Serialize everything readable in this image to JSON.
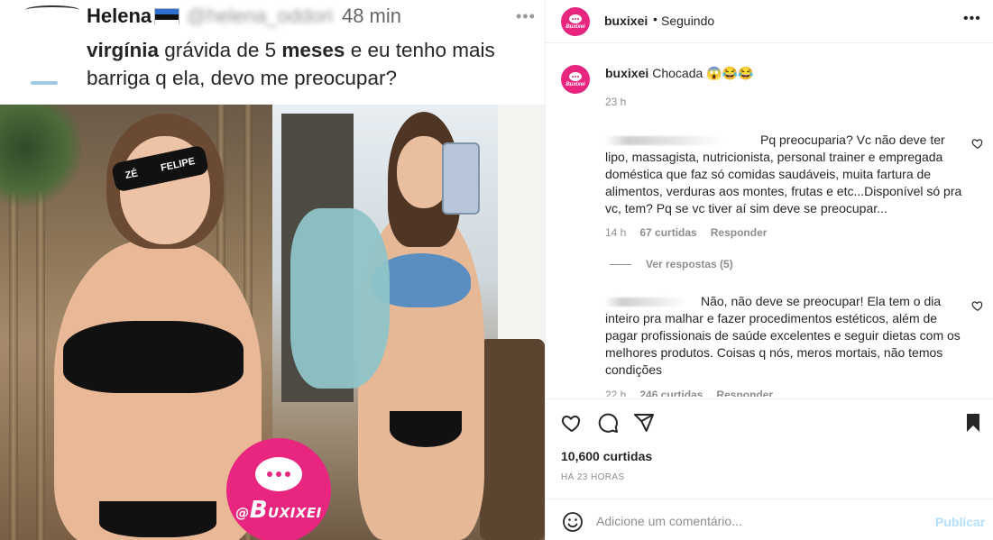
{
  "media": {
    "tweet": {
      "name": "Helena",
      "handle": "@helena_oddori",
      "time": "48 min",
      "text_bold_1": "virgínia",
      "text_mid": " grávida de 5 ",
      "text_bold_2": "meses",
      "text_end": " e eu tenho mais barriga q ela, devo me preocupar?"
    },
    "photo_left_glasses": [
      "ZÉ",
      "FELIPE"
    ],
    "brand_badge": {
      "at": "@",
      "b": "B",
      "text": "UXIXEI"
    }
  },
  "header": {
    "username": "buxixei",
    "separator": "•",
    "follow_status": "Seguindo"
  },
  "caption": {
    "username": "buxixei",
    "text": "Chocada 😱😂😂",
    "time": "23 h"
  },
  "comments": [
    {
      "text": "Pq preocuparia? Vc não deve ter lipo, massagista, nutricionista, personal trainer e empregada doméstica que faz só comidas saudáveis, muita fartura de alimentos, verduras aos montes, frutas e etc...Disponível só pra vc, tem? Pq se vc tiver aí sim deve se preocupar...",
      "time": "14 h",
      "likes": "67 curtidas",
      "reply": "Responder",
      "view_replies": "Ver respostas (5)"
    },
    {
      "text": "Não, não deve se preocupar! Ela tem o dia inteiro pra malhar e fazer procedimentos estéticos, além de pagar profissionais de saúde excelentes e seguir dietas com os melhores produtos. Coisas q nós, meros mortais, não temos condições",
      "time": "22 h",
      "likes": "246 curtidas",
      "reply": "Responder"
    }
  ],
  "post": {
    "likes": "10,600 curtidas",
    "time": "HÁ 23 HORAS"
  },
  "comment_box": {
    "placeholder": "Adicione um comentário...",
    "publish": "Publicar"
  },
  "colors": {
    "brand_pink": "#e8267f",
    "text": "#262626",
    "muted": "#8e8e8e",
    "publish_disabled": "#b2dffc"
  },
  "icons": [
    "heart-icon",
    "comment-icon",
    "share-icon",
    "bookmark-icon",
    "emoji-icon",
    "more-icon"
  ]
}
